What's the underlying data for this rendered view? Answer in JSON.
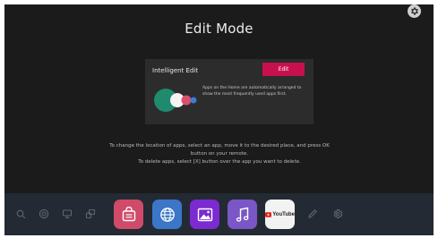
{
  "title": "Edit Mode",
  "card": {
    "title": "Intelligent Edit",
    "button_label": "Edit",
    "description": "Apps on the Home are automatically arranged to show the most frequently used apps first."
  },
  "instructions": [
    "To change the location of apps, select an app, move it to the desired place, and press OK",
    "button on your remote.",
    "To delete apps, select [X] button over the app you want to delete."
  ],
  "dock": {
    "left_icons": [
      "search-icon",
      "voice-icon",
      "input-icon",
      "screen-share-icon"
    ],
    "apps": [
      {
        "name": "shop-app",
        "color": "#d04a6a"
      },
      {
        "name": "web-browser-app",
        "color": "#3b76c8"
      },
      {
        "name": "gallery-app",
        "color": "#7b2bd0"
      },
      {
        "name": "music-app",
        "color": "#7b56c6"
      },
      {
        "name": "youtube-app",
        "label": "YouTube",
        "color": "#f2f2f2"
      }
    ],
    "right_icons": [
      "edit-pencil-icon",
      "settings-icon"
    ]
  },
  "colors": {
    "background": "#1b1b1b",
    "accent": "#c8104e",
    "dock": "#242a33"
  }
}
